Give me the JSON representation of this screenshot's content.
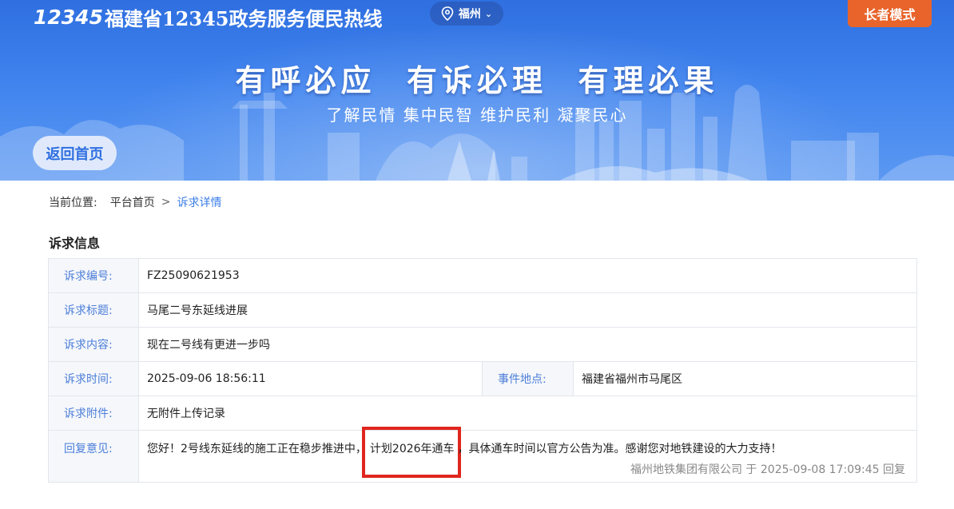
{
  "header": {
    "logo_mark": "12345",
    "site_title": "福建省12345政务服务便民热线",
    "city": "福州",
    "elder_mode_label": "长者模式",
    "slogan": "有呼必应  有诉必理  有理必果",
    "sub_slogan": "了解民情 集中民智 维护民利 凝聚民心",
    "back_home_label": "返回首页"
  },
  "breadcrumb": {
    "prefix": "当前位置:",
    "home": "平台首页",
    "separator": ">",
    "current": "诉求详情"
  },
  "section_title": "诉求信息",
  "request": {
    "number_label": "诉求编号:",
    "number": "FZ25090621953",
    "title_label": "诉求标题:",
    "title": "马尾二号东延线进展",
    "content_label": "诉求内容:",
    "content": "现在二号线有更进一步吗",
    "time_label": "诉求时间:",
    "time": "2025-09-06 18:56:11",
    "location_label": "事件地点:",
    "location": "福建省福州市马尾区",
    "attachment_label": "诉求附件:",
    "attachment": "无附件上传记录",
    "reply_label": "回复意见:",
    "reply_part1": "您好！2号线东延线的施工正在稳步推进中，",
    "reply_highlight": "计划2026年通车",
    "reply_part2": "，具体通车时间以官方公告为准。感谢您对地铁建设的大力支持！",
    "reply_org": "福州地铁集团有限公司",
    "reply_at": "于",
    "reply_time": "2025-09-08 17:09:45",
    "reply_suffix": "回复"
  },
  "colors": {
    "banner_blue": "#3f83ee",
    "elder_button": "#e8642b",
    "label_blue": "#4c7ed8",
    "highlight_red": "#e0261e"
  }
}
